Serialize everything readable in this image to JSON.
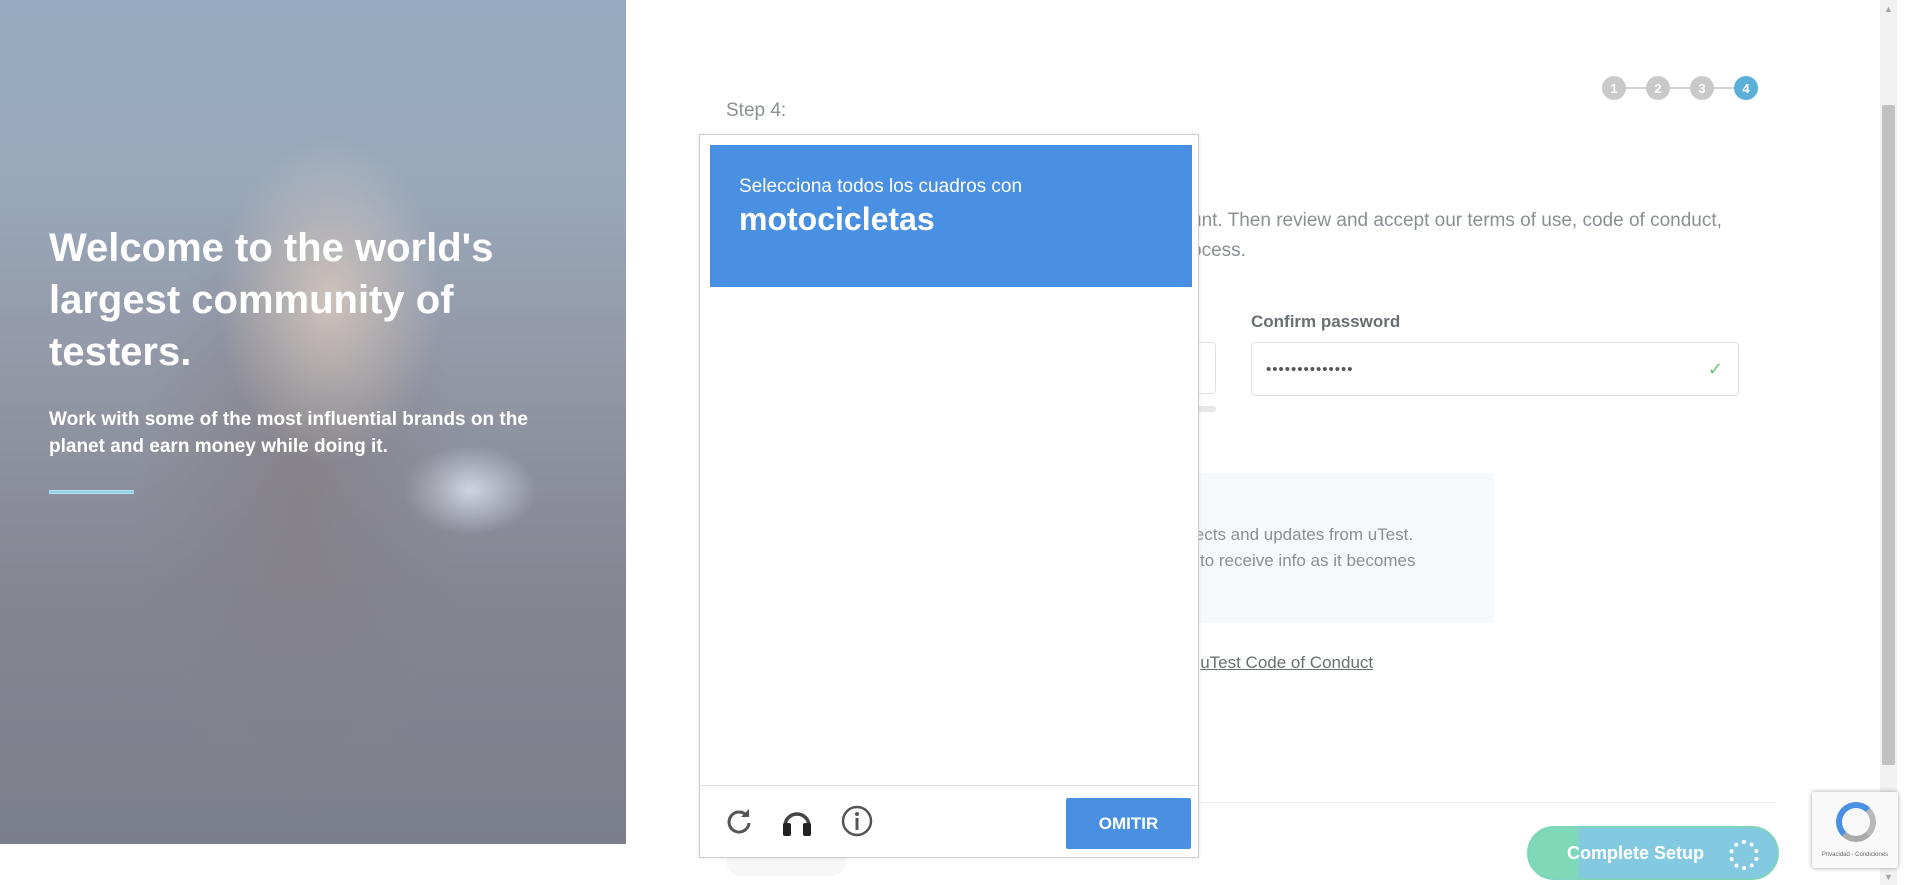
{
  "hero": {
    "title": "Welcome to the world's largest community of testers.",
    "subtitle": "Work with some of the most influential brands on the planet and earn money while doing it."
  },
  "form": {
    "step_label": "Step 4:",
    "steps": [
      "1",
      "2",
      "3",
      "4"
    ],
    "active_step": "4",
    "intro_text_visible": "unt. Then review and accept our terms of use, code of conduct, ocess.",
    "intro_line_1": "unt. Then review and accept our terms of use, code of conduct,",
    "intro_line_2": "ocess.",
    "confirm_password_label": "Confirm password",
    "confirm_password_value": "••••••••••••••",
    "info_line_1": "jects and updates from uTest.",
    "info_line_2": "to receive info as it becomes",
    "coc_prefix": "e ",
    "coc_link": "uTest Code of Conduct",
    "complete_button": "Complete Setup"
  },
  "captcha": {
    "instruction": "Selecciona todos los cuadros con",
    "target": "motocicletas",
    "skip_button": "OMITIR",
    "reload_icon": "reload-icon",
    "audio_icon": "headphones-icon",
    "info_icon": "info-icon"
  },
  "recaptcha_badge": {
    "text": "Privacidad - Condiciones"
  },
  "colors": {
    "captcha_blue": "#4a90e2",
    "step_active": "#5ab0d6",
    "check_green": "#6cc37a"
  }
}
